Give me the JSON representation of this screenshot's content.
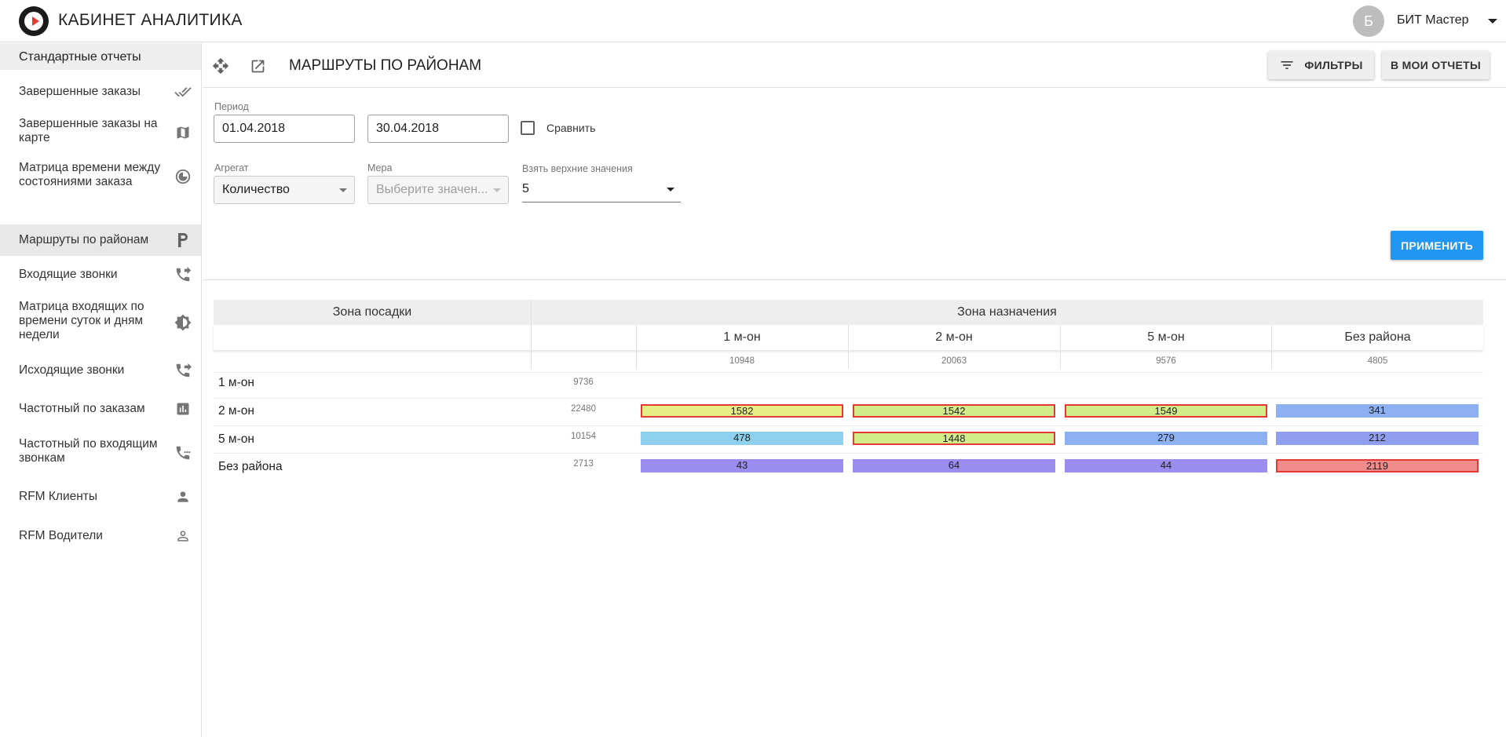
{
  "app": {
    "title": "КАБИНЕТ АНАЛИТИКА"
  },
  "user": {
    "initial": "Б",
    "name": "БИТ Мастер"
  },
  "sidebar": {
    "header": "Стандартные отчеты",
    "items": [
      {
        "label": "Завершенные заказы",
        "icon": "done-all-icon"
      },
      {
        "label": "Завершенные заказы на карте",
        "icon": "map-icon"
      },
      {
        "label": "Матрица времени между состояниями заказа",
        "icon": "timelapse-icon"
      },
      {
        "label": "Маршруты по районам",
        "icon": "parking-icon",
        "active": true
      },
      {
        "label": "Входящие звонки",
        "icon": "phone-forwarded-icon"
      },
      {
        "label": "Матрица входящих по времени суток и дням недели",
        "icon": "brightness-icon"
      },
      {
        "label": "Исходящие звонки",
        "icon": "phone-outgoing-icon"
      },
      {
        "label": "Частотный по заказам",
        "icon": "bar-chart-icon"
      },
      {
        "label": "Частотный по входящим звонкам",
        "icon": "phone-log-icon"
      },
      {
        "label": "RFM Клиенты",
        "icon": "person-icon"
      },
      {
        "label": "RFM Водители",
        "icon": "person-outline-icon"
      }
    ]
  },
  "toolbar": {
    "title": "МАРШРУТЫ ПО РАЙОНАМ",
    "filters_label": "ФИЛЬТРЫ",
    "my_reports_label": "В МОИ ОТЧЕТЫ"
  },
  "filters": {
    "period_label": "Период",
    "date_from": "01.04.2018",
    "date_to": "30.04.2018",
    "compare_label": "Сравнить",
    "compare_checked": false,
    "aggregate_label": "Агрегат",
    "aggregate_value": "Количество",
    "measure_label": "Мера",
    "measure_placeholder": "Выберите значен...",
    "top_label": "Взять верхние значения",
    "top_value": "5",
    "apply_label": "ПРИМЕНИТЬ"
  },
  "colors": {
    "accent": "#2196f3",
    "yellow": "#e6ef86",
    "yellow_green": "#d3ec8a",
    "light_blue": "#8fd0ee",
    "blue": "#8cb0f2",
    "blue_violet": "#909ef0",
    "violet": "#9b8cf0",
    "red": "#f08c8c",
    "highlight_border": "#e53935"
  },
  "table": {
    "origin_header": "Зона посадки",
    "dest_header": "Зона назначения",
    "columns": [
      {
        "label": "1 м-он",
        "total": "10948"
      },
      {
        "label": "2 м-он",
        "total": "20063"
      },
      {
        "label": "5 м-он",
        "total": "9576"
      },
      {
        "label": "Без района",
        "total": "4805"
      }
    ],
    "rows": [
      {
        "label": "1 м-он",
        "total": "9736",
        "cells": [
          null,
          null,
          null,
          null
        ]
      },
      {
        "label": "2 м-он",
        "total": "22480",
        "cells": [
          {
            "value": "1582",
            "color": "yellow",
            "highlight": true
          },
          {
            "value": "1542",
            "color": "yellow_green",
            "highlight": true
          },
          {
            "value": "1549",
            "color": "yellow_green",
            "highlight": true
          },
          {
            "value": "341",
            "color": "blue",
            "highlight": false
          }
        ]
      },
      {
        "label": "5 м-он",
        "total": "10154",
        "cells": [
          {
            "value": "478",
            "color": "light_blue",
            "highlight": false
          },
          {
            "value": "1448",
            "color": "yellow_green",
            "highlight": true
          },
          {
            "value": "279",
            "color": "blue",
            "highlight": false
          },
          {
            "value": "212",
            "color": "blue_violet",
            "highlight": false
          }
        ]
      },
      {
        "label": "Без района",
        "total": "2713",
        "cells": [
          {
            "value": "43",
            "color": "violet",
            "highlight": false
          },
          {
            "value": "64",
            "color": "violet",
            "highlight": false
          },
          {
            "value": "44",
            "color": "violet",
            "highlight": false
          },
          {
            "value": "2119",
            "color": "red",
            "highlight": true
          }
        ]
      }
    ]
  }
}
